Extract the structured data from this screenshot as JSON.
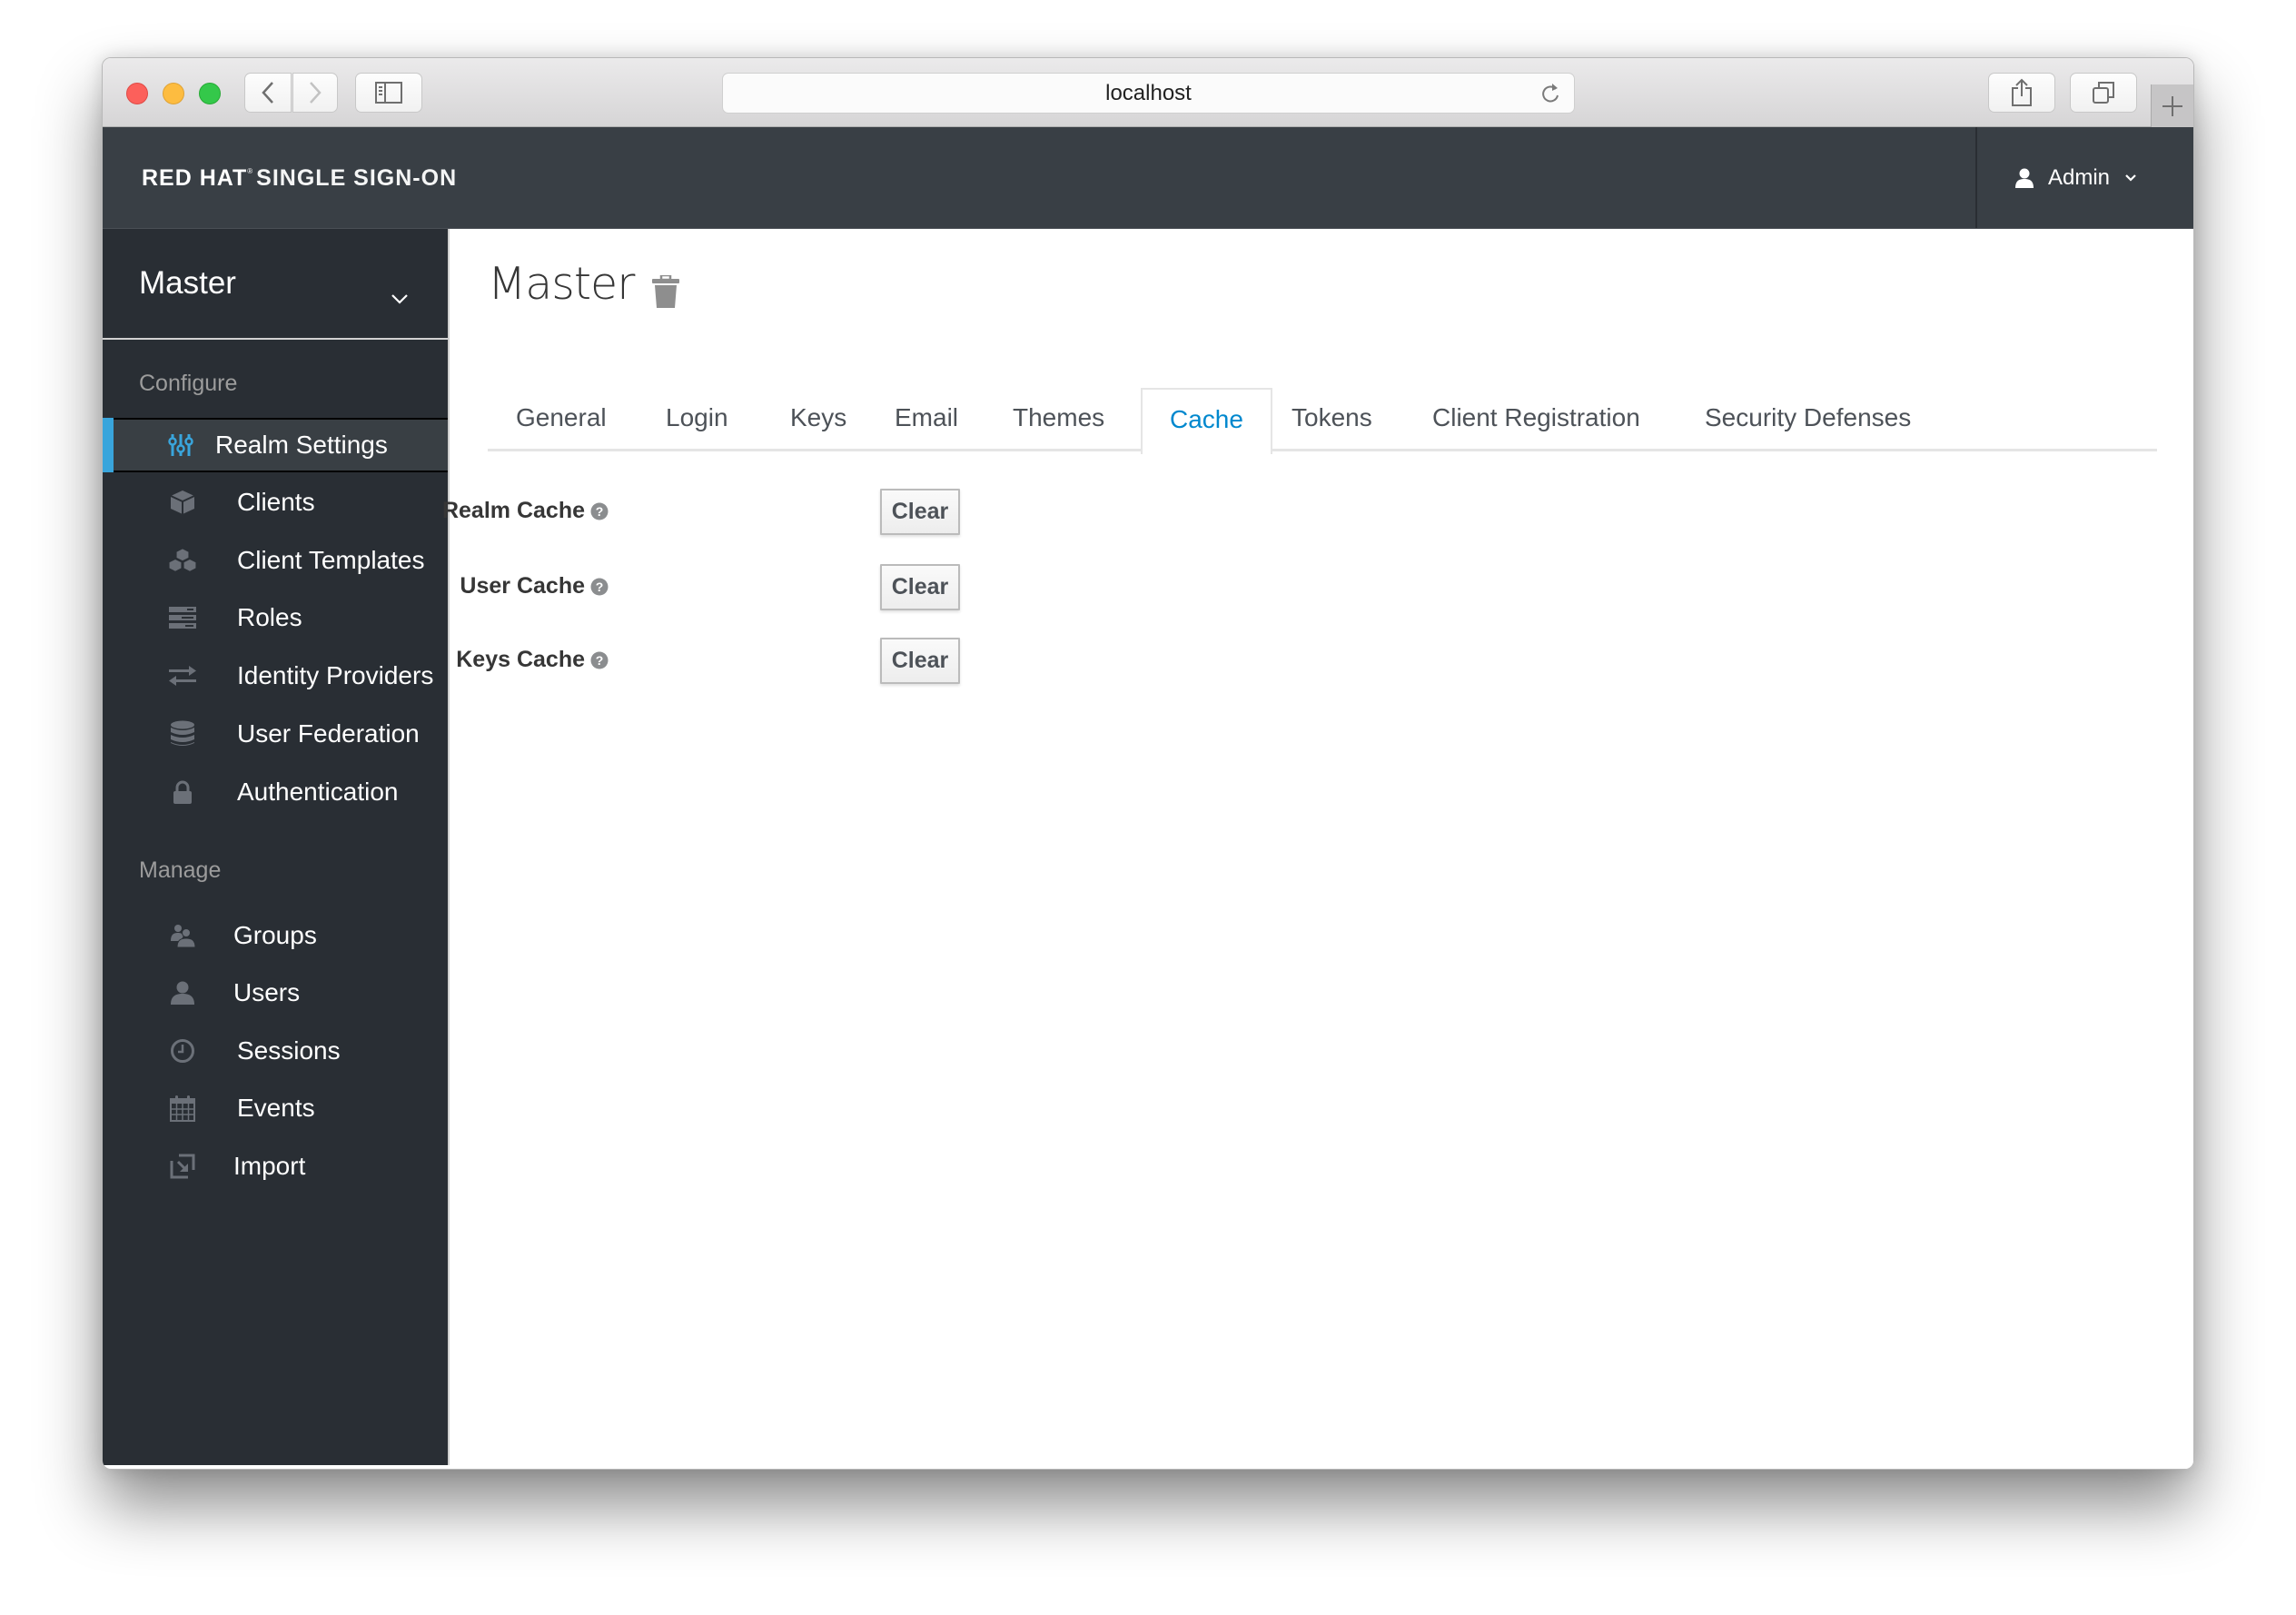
{
  "browser": {
    "url": "localhost",
    "controls": {
      "back": "back-icon",
      "forward": "forward-icon",
      "sidebar": "sidebar-toggle-icon",
      "reload": "reload-icon",
      "share": "share-icon",
      "tabs": "tabs-icon",
      "new_tab": "plus-icon"
    }
  },
  "header": {
    "brand_primary": "RED HAT",
    "brand_reg": "®",
    "brand_secondary": "SINGLE SIGN-ON",
    "user": "Admin"
  },
  "sidebar": {
    "realm": "Master",
    "sections": [
      {
        "title": "Configure",
        "items": [
          {
            "label": "Realm Settings",
            "icon": "sliders-icon",
            "active": true
          },
          {
            "label": "Clients",
            "icon": "cube-icon"
          },
          {
            "label": "Client Templates",
            "icon": "cubes-icon"
          },
          {
            "label": "Roles",
            "icon": "server-icon"
          },
          {
            "label": "Identity Providers",
            "icon": "exchange-icon"
          },
          {
            "label": "User Federation",
            "icon": "database-icon"
          },
          {
            "label": "Authentication",
            "icon": "lock-icon"
          }
        ]
      },
      {
        "title": "Manage",
        "items": [
          {
            "label": "Groups",
            "icon": "users-icon"
          },
          {
            "label": "Users",
            "icon": "user-icon"
          },
          {
            "label": "Sessions",
            "icon": "clock-icon"
          },
          {
            "label": "Events",
            "icon": "calendar-icon"
          },
          {
            "label": "Import",
            "icon": "import-icon"
          }
        ]
      }
    ]
  },
  "main": {
    "title": "Master",
    "tabs": [
      {
        "label": "General"
      },
      {
        "label": "Login"
      },
      {
        "label": "Keys"
      },
      {
        "label": "Email"
      },
      {
        "label": "Themes"
      },
      {
        "label": "Cache",
        "active": true
      },
      {
        "label": "Tokens"
      },
      {
        "label": "Client Registration"
      },
      {
        "label": "Security Defenses"
      }
    ],
    "cache_rows": [
      {
        "label": "Realm Cache",
        "button": "Clear"
      },
      {
        "label": "User Cache",
        "button": "Clear"
      },
      {
        "label": "Keys Cache",
        "button": "Clear"
      }
    ]
  },
  "colors": {
    "accent": "#0088ce",
    "active_bar": "#39a5dc",
    "header_bg": "#393f45",
    "sidebar_bg": "#292e34"
  }
}
